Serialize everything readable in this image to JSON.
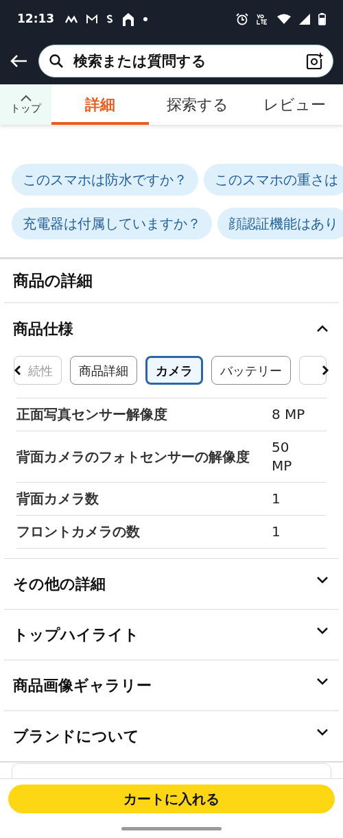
{
  "status_bar": {
    "time": "12:13"
  },
  "search": {
    "placeholder": "検索または質問する"
  },
  "top_button": {
    "label": "トップ"
  },
  "tabs": [
    {
      "label": "詳細",
      "selected": true
    },
    {
      "label": "探索する",
      "selected": false
    },
    {
      "label": "レビュー",
      "selected": false
    }
  ],
  "question_chips": [
    [
      "このスマホは防水ですか？",
      "このスマホの重さは"
    ],
    [
      "充電器は付属していますか？",
      "顔認証機能はあり"
    ]
  ],
  "section_title": "商品の詳細",
  "spec": {
    "title": "商品仕様",
    "expanded": true,
    "filters": [
      {
        "label": "続性",
        "selected": false,
        "faded": true
      },
      {
        "label": "商品詳細",
        "selected": false,
        "faded": false
      },
      {
        "label": "カメラ",
        "selected": true,
        "faded": false
      },
      {
        "label": "バッテリー",
        "selected": false,
        "faded": false
      }
    ],
    "rows": [
      {
        "name": "正面写真センサー解像度",
        "value": "8 MP"
      },
      {
        "name": "背面カメラのフォトセンサーの解像度",
        "value": "50 MP"
      },
      {
        "name": "背面カメラ数",
        "value": "1"
      },
      {
        "name": "フロントカメラの数",
        "value": "1"
      }
    ]
  },
  "accordions": [
    {
      "title": "その他の詳細",
      "expanded": false
    },
    {
      "title": "トップハイライト",
      "expanded": false
    },
    {
      "title": "商品画像ギャラリー",
      "expanded": false
    },
    {
      "title": "ブランドについて",
      "expanded": false
    }
  ],
  "cart_button": {
    "label": "カートに入れる"
  }
}
